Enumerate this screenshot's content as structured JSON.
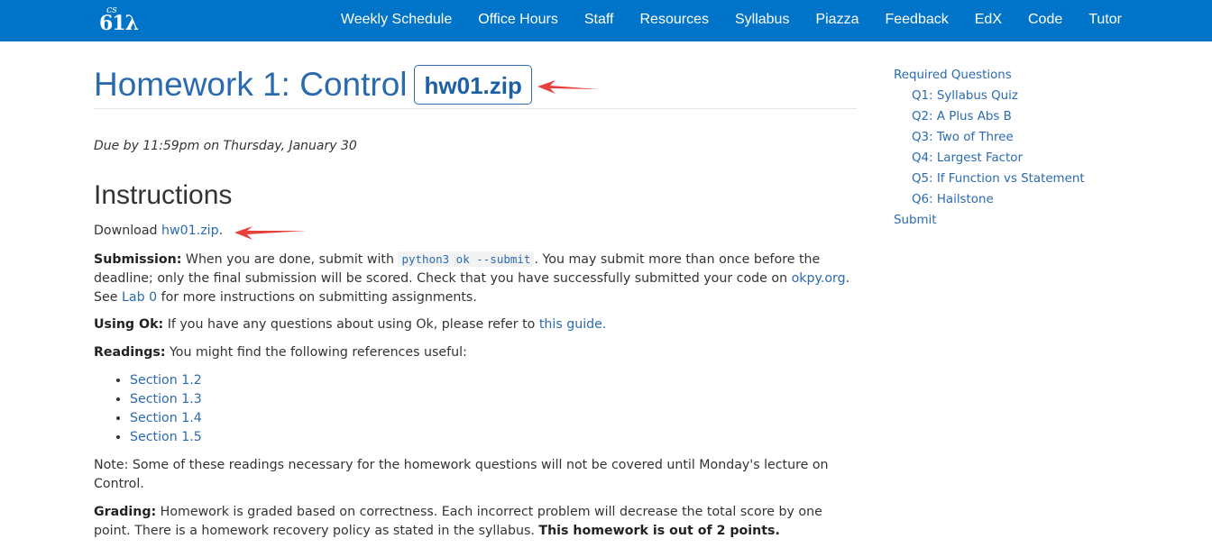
{
  "navbar": {
    "logo_cs": "cs",
    "logo_num": "61λ",
    "links": [
      "Weekly Schedule",
      "Office Hours",
      "Staff",
      "Resources",
      "Syllabus",
      "Piazza",
      "Feedback",
      "EdX",
      "Code",
      "Tutor"
    ]
  },
  "header": {
    "title": "Homework 1: Control",
    "zip_label": "hw01.zip"
  },
  "due": "Due by 11:59pm on Thursday, January 30",
  "instructions": {
    "heading": "Instructions",
    "download_prefix": "Download ",
    "download_link": "hw01.zip",
    "download_suffix": ".",
    "submission_label": "Submission:",
    "submission_text1": " When you are done, submit with ",
    "submission_cmd": "python3 ok --submit",
    "submission_text2": ". You may submit more than once before the deadline; only the final submission will be scored. Check that you have successfully submitted your code on ",
    "okpy_link": "okpy.org",
    "submission_text3": ". See ",
    "lab0_link": "Lab 0",
    "submission_text4": " for more instructions on submitting assignments.",
    "usingok_label": "Using Ok:",
    "usingok_text": " If you have any questions about using Ok, please refer to ",
    "guide_link": "this guide.",
    "readings_label": "Readings:",
    "readings_text": " You might find the following references useful:",
    "readings": [
      "Section 1.2",
      "Section 1.3",
      "Section 1.4",
      "Section 1.5"
    ],
    "note": "Note: Some of these readings necessary for the homework questions will not be covered until Monday's lecture on Control.",
    "grading_label": "Grading:",
    "grading_text": " Homework is graded based on correctness. Each incorrect problem will decrease the total score by one point. There is a homework recovery policy as stated in the syllabus. ",
    "grading_bold": "This homework is out of 2 points."
  },
  "toc": {
    "heading": "Required Questions",
    "items": [
      "Q1: Syllabus Quiz",
      "Q2: A Plus Abs B",
      "Q3: Two of Three",
      "Q4: Largest Factor",
      "Q5: If Function vs Statement",
      "Q6: Hailstone"
    ],
    "submit": "Submit"
  },
  "colors": {
    "navbar": "#0074c8",
    "link": "#2a6bb0",
    "annotation_arrow": "#e8403a"
  }
}
